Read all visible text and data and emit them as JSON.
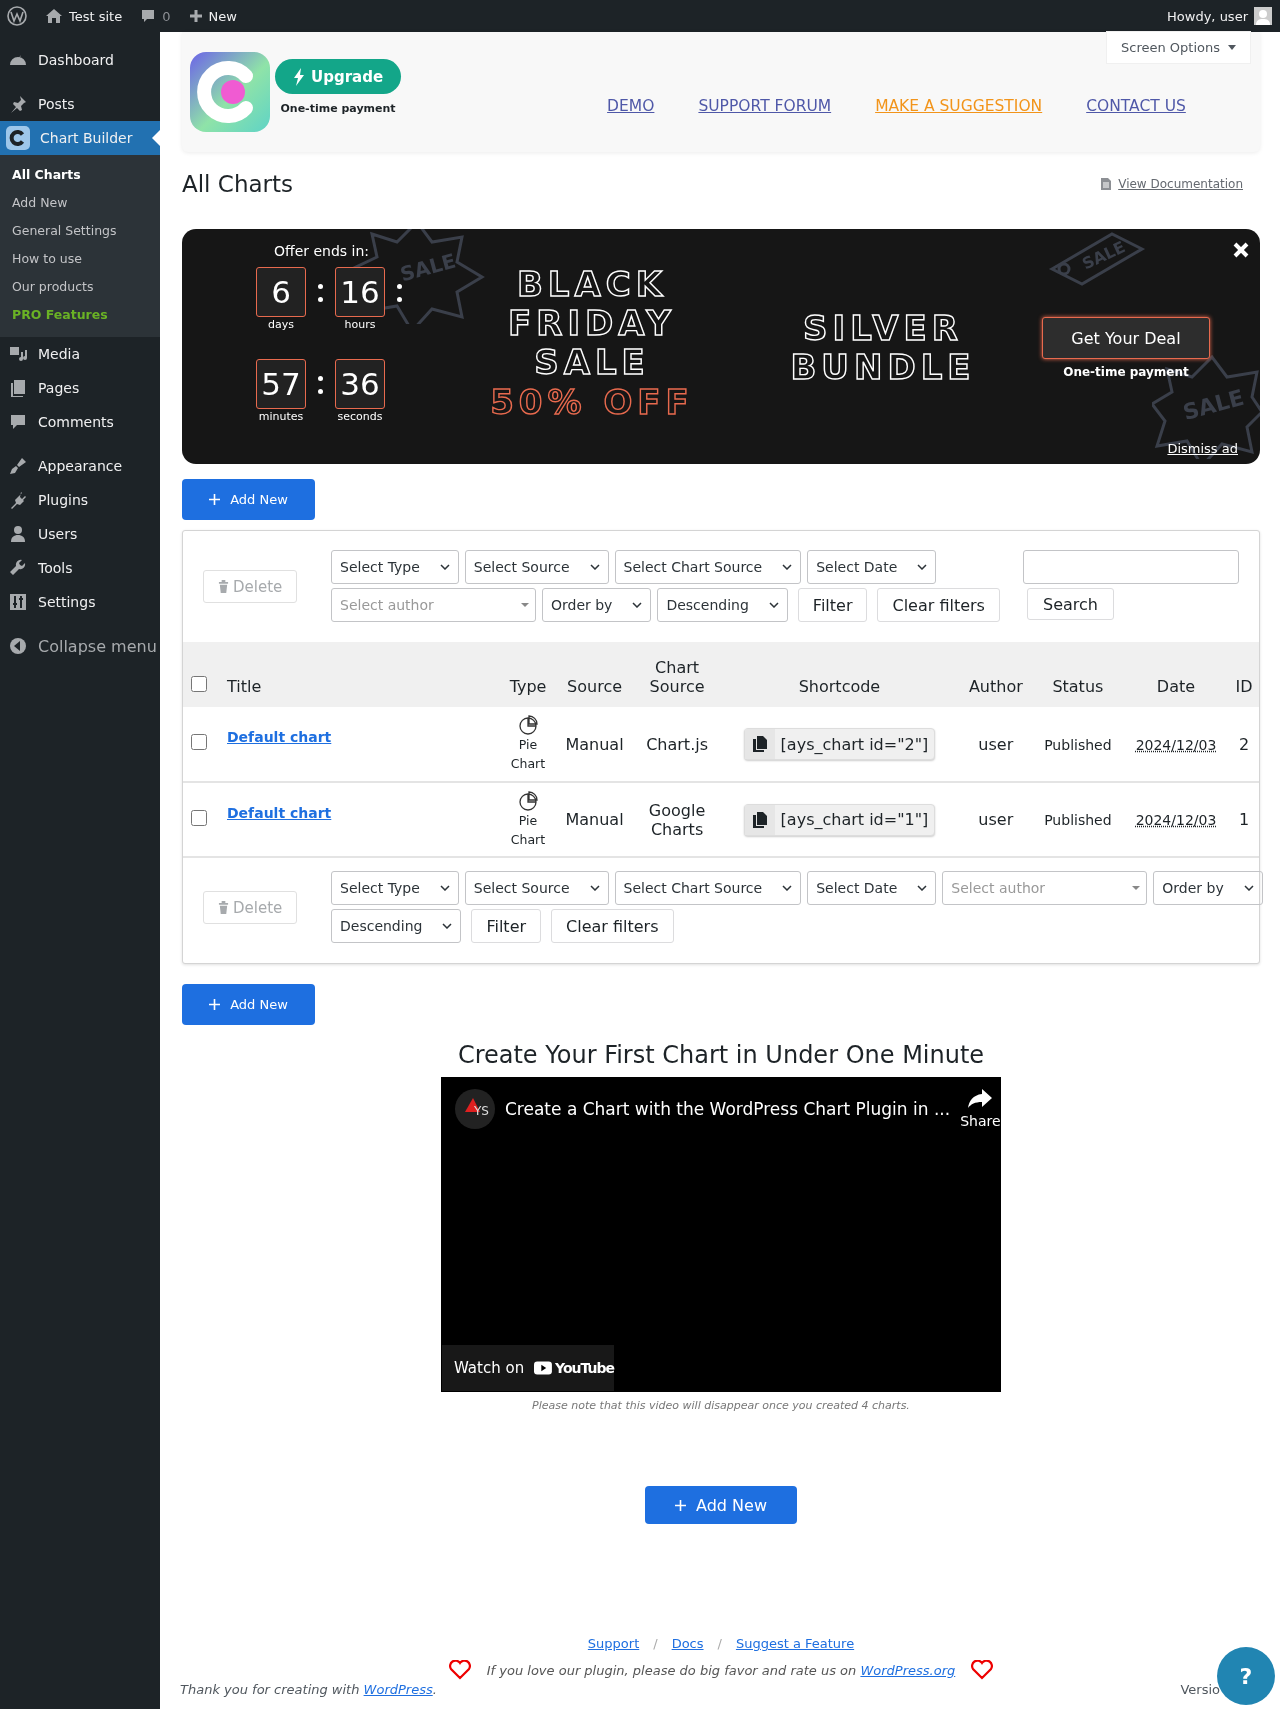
{
  "admin_bar": {
    "site": "Test site",
    "comments": "0",
    "new": "New",
    "greeting": "Howdy, user"
  },
  "sidebar": {
    "items": [
      {
        "label": "Dashboard",
        "kind": "menu",
        "selected": false
      },
      {
        "label": "Posts",
        "kind": "menu",
        "selected": false
      },
      {
        "label": "Chart Builder",
        "kind": "menu",
        "selected": true,
        "children": [
          {
            "label": "All Charts",
            "kind": "link",
            "selected": true
          },
          {
            "label": "Add New",
            "kind": "link",
            "selected": false
          },
          {
            "label": "General Settings",
            "kind": "link",
            "selected": false
          },
          {
            "label": "How to use",
            "kind": "link",
            "selected": false
          },
          {
            "label": "Our products",
            "kind": "link",
            "selected": false
          },
          {
            "label": "PRO Features",
            "kind": "pro",
            "selected": false
          }
        ]
      },
      {
        "label": "Media",
        "kind": "menu",
        "selected": false
      },
      {
        "label": "Pages",
        "kind": "menu",
        "selected": false
      },
      {
        "label": "Comments",
        "kind": "menu",
        "selected": false
      },
      {
        "label": "Appearance",
        "kind": "menu",
        "selected": false
      },
      {
        "label": "Plugins",
        "kind": "menu",
        "selected": false
      },
      {
        "label": "Users",
        "kind": "menu",
        "selected": false
      },
      {
        "label": "Tools",
        "kind": "menu",
        "selected": false
      },
      {
        "label": "Settings",
        "kind": "menu",
        "selected": false
      },
      {
        "label": "Collapse menu",
        "kind": "collapse",
        "selected": false
      }
    ]
  },
  "header": {
    "screen_options": "Screen Options",
    "upgrade": "Upgrade",
    "upgrade_note": "One-time payment",
    "nav": [
      {
        "label": "DEMO",
        "kind": "link"
      },
      {
        "label": "SUPPORT FORUM",
        "kind": "link"
      },
      {
        "label": "MAKE A SUGGESTION",
        "kind": "highlight"
      },
      {
        "label": "CONTACT US",
        "kind": "link"
      }
    ]
  },
  "page_title": "All Charts",
  "doc_link": "View Documentation",
  "promo": {
    "offer_label": "Offer ends in:",
    "countdown": [
      {
        "value": "6",
        "unit": "days"
      },
      {
        "value": "16",
        "unit": "hours"
      },
      {
        "value": "57",
        "unit": "minutes"
      },
      {
        "value": "36",
        "unit": "seconds"
      }
    ],
    "headline": [
      "BLACK",
      "FRIDAY",
      "SALE"
    ],
    "discount": "50% OFF",
    "product": [
      "SILVER",
      "BUNDLE"
    ],
    "cta": "Get Your Deal",
    "cta_note": "One-time payment",
    "dismiss": "Dismiss ad",
    "stamps": [
      "SALE",
      "SALE",
      "SALE"
    ]
  },
  "add_new": [
    "Add New",
    "Add New",
    "Add New"
  ],
  "filters_top": {
    "delete": "Delete",
    "rows": [
      [
        {
          "kind": "select",
          "label": "Select Type"
        },
        {
          "kind": "select",
          "label": "Select Source"
        },
        {
          "kind": "select",
          "label": "Select Chart Source"
        },
        {
          "kind": "select",
          "label": "Select Date"
        }
      ],
      [
        {
          "kind": "author",
          "placeholder": "Select author"
        },
        {
          "kind": "select",
          "label": "Order by"
        },
        {
          "kind": "select",
          "label": "Descending"
        },
        {
          "kind": "button",
          "label": "Filter"
        },
        {
          "kind": "button",
          "label": "Clear filters"
        }
      ]
    ],
    "search": "Search"
  },
  "table": {
    "select_all_checked": false,
    "columns": [
      "Title",
      "Type",
      "Source",
      "Chart Source",
      "Shortcode",
      "Author",
      "Status",
      "Date",
      "ID"
    ],
    "rows": [
      {
        "checked": false,
        "title": "Default chart",
        "type": "Pie Chart",
        "source": "Manual",
        "chart_source": "Chart.js",
        "shortcode": "[ays_chart id=\"2\"]",
        "author": "user",
        "status": "Published",
        "date": "2024/12/03",
        "id": "2"
      },
      {
        "checked": false,
        "title": "Default chart",
        "type": "Pie Chart",
        "source": "Manual",
        "chart_source": "Google Charts",
        "shortcode": "[ays_chart id=\"1\"]",
        "author": "user",
        "status": "Published",
        "date": "2024/12/03",
        "id": "1"
      }
    ]
  },
  "filters_bottom": {
    "delete": "Delete",
    "rows": [
      [
        {
          "kind": "select",
          "label": "Select Type"
        },
        {
          "kind": "select",
          "label": "Select Source"
        },
        {
          "kind": "select",
          "label": "Select Chart Source"
        },
        {
          "kind": "select",
          "label": "Select Date"
        },
        {
          "kind": "author",
          "placeholder": "Select author"
        },
        {
          "kind": "select",
          "label": "Order by"
        }
      ],
      [
        {
          "kind": "select",
          "label": "Descending"
        },
        {
          "kind": "button",
          "label": "Filter"
        },
        {
          "kind": "button",
          "label": "Clear filters"
        }
      ]
    ]
  },
  "video": {
    "heading": "Create Your First Chart in Under One Minute",
    "channel_badge": "YS",
    "title": "Create a Chart with the WordPress Chart Plugin in ...",
    "share": "Share",
    "watch": "Watch on",
    "youtube": "YouTube",
    "note": "Please note that this video will disappear once you created 4 charts."
  },
  "footer": {
    "links": [
      "Support",
      "Docs",
      "Suggest a Feature"
    ],
    "separators": [
      "/",
      "/"
    ],
    "thanks_end": ".",
    "rate_text": "If you love our plugin, please do big favor and rate us on",
    "rate_link": "WordPress.org",
    "thanks": "Thank you for creating with",
    "thanks_link": "WordPress",
    "version": "Versio",
    "help": "?"
  }
}
